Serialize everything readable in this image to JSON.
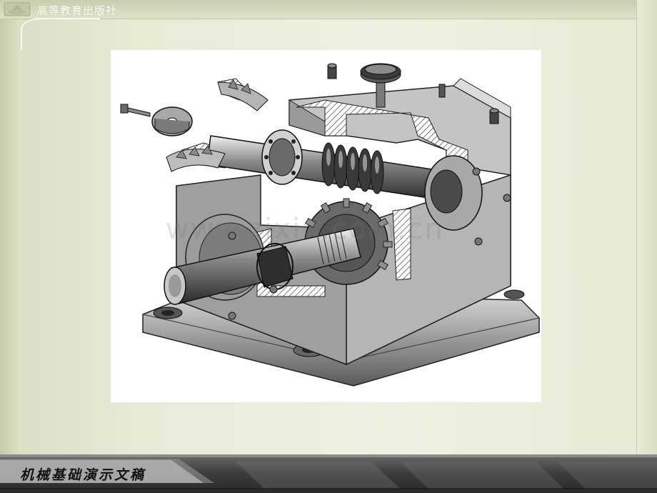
{
  "header": {
    "publisher": "高等教育出版社"
  },
  "figure": {
    "watermark": "www.zixin.com.cn"
  },
  "footer": {
    "title": "机械基础演示文稿"
  },
  "colors": {
    "slide_bg": "#e7ebd6",
    "footer_dark": "#2a2a2a",
    "metal": "#8c8c8c"
  }
}
